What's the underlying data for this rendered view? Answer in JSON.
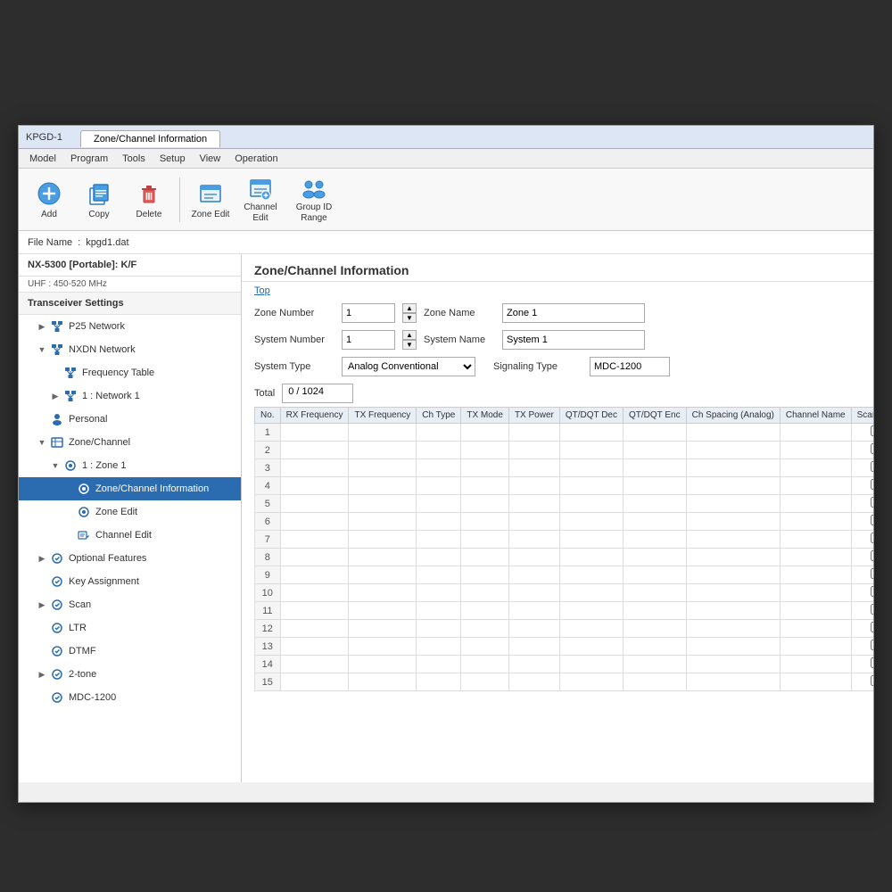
{
  "window": {
    "title": "KPGD-1",
    "tab_zone_channel": "Zone/Channel Information",
    "tab_operation": "Operation"
  },
  "menu": {
    "items": [
      "Model",
      "Program",
      "Tools",
      "Setup",
      "View",
      "Operation"
    ]
  },
  "toolbar": {
    "buttons": [
      {
        "id": "add",
        "label": "Add",
        "icon": "add-icon"
      },
      {
        "id": "copy",
        "label": "Copy",
        "icon": "copy-icon"
      },
      {
        "id": "delete",
        "label": "Delete",
        "icon": "delete-icon"
      },
      {
        "id": "zone-edit",
        "label": "Zone Edit",
        "icon": "zone-edit-icon"
      },
      {
        "id": "channel-edit",
        "label": "Channel Edit",
        "icon": "channel-edit-icon"
      },
      {
        "id": "group-id-range",
        "label": "Group ID Range",
        "icon": "group-id-icon"
      }
    ]
  },
  "file_info": {
    "label": "File Name",
    "value": "kpgd1.dat"
  },
  "sidebar": {
    "device_name": "NX-5300 [Portable]: K/F",
    "frequency": "UHF : 450-520 MHz",
    "section_header": "Transceiver Settings",
    "items": [
      {
        "id": "p25-network",
        "label": "P25 Network",
        "level": 1,
        "icon": "network-icon",
        "expandable": true,
        "expanded": false
      },
      {
        "id": "nxdn-network",
        "label": "NXDN Network",
        "level": 1,
        "icon": "network-icon",
        "expandable": true,
        "expanded": true
      },
      {
        "id": "frequency-table",
        "label": "Frequency Table",
        "level": 2,
        "icon": "table-icon",
        "expandable": false
      },
      {
        "id": "network-1",
        "label": "1 : Network 1",
        "level": 2,
        "icon": "network-icon",
        "expandable": true,
        "expanded": false
      },
      {
        "id": "personal",
        "label": "Personal",
        "level": 1,
        "icon": "personal-icon",
        "expandable": false
      },
      {
        "id": "zone-channel",
        "label": "Zone/Channel",
        "level": 1,
        "icon": "zone-icon",
        "expandable": true,
        "expanded": true
      },
      {
        "id": "zone-1",
        "label": "1 : Zone 1",
        "level": 2,
        "icon": "zone-sub-icon",
        "expandable": true,
        "expanded": true
      },
      {
        "id": "zone-channel-info",
        "label": "Zone/Channel Information",
        "level": 3,
        "icon": "info-icon",
        "selected": true
      },
      {
        "id": "zone-edit",
        "label": "Zone Edit",
        "level": 3,
        "icon": "zone-edit-icon"
      },
      {
        "id": "channel-edit",
        "label": "Channel Edit",
        "level": 3,
        "icon": "channel-edit-icon"
      },
      {
        "id": "optional-features",
        "label": "Optional Features",
        "level": 1,
        "icon": "features-icon",
        "expandable": true,
        "expanded": false
      },
      {
        "id": "key-assignment",
        "label": "Key Assignment",
        "level": 1,
        "icon": "key-icon",
        "expandable": false
      },
      {
        "id": "scan",
        "label": "Scan",
        "level": 1,
        "icon": "scan-icon",
        "expandable": true,
        "expanded": false
      },
      {
        "id": "ltr",
        "label": "LTR",
        "level": 1,
        "icon": "ltr-icon",
        "expandable": false
      },
      {
        "id": "dtmf",
        "label": "DTMF",
        "level": 1,
        "icon": "dtmf-icon",
        "expandable": false
      },
      {
        "id": "2tone",
        "label": "2-tone",
        "level": 1,
        "icon": "tone-icon",
        "expandable": true,
        "expanded": false
      },
      {
        "id": "mdc-1200",
        "label": "MDC-1200",
        "level": 1,
        "icon": "mdc-icon",
        "expandable": false
      }
    ]
  },
  "content": {
    "title": "Zone/Channel Information",
    "top_link": "Top",
    "zone_number_label": "Zone Number",
    "zone_number_value": "1",
    "zone_name_label": "Zone Name",
    "zone_name_value": "Zone 1",
    "system_number_label": "System Number",
    "system_number_value": "1",
    "system_name_label": "System Name",
    "system_name_value": "System 1",
    "system_type_label": "System Type",
    "system_type_value": "Analog Conventional",
    "signaling_type_label": "Signaling Type",
    "signaling_type_value": "MDC-1200",
    "total_label": "Total",
    "total_value": "0 / 1024",
    "table_headers": [
      "No.",
      "RX Frequency",
      "TX Frequency",
      "Ch Type",
      "TX Mode",
      "TX Power",
      "QT/DQT Dec",
      "QT/DQT Enc",
      "Ch Spacing (Analog)",
      "Channel Name",
      "Scan Add"
    ],
    "table_rows": 15
  }
}
